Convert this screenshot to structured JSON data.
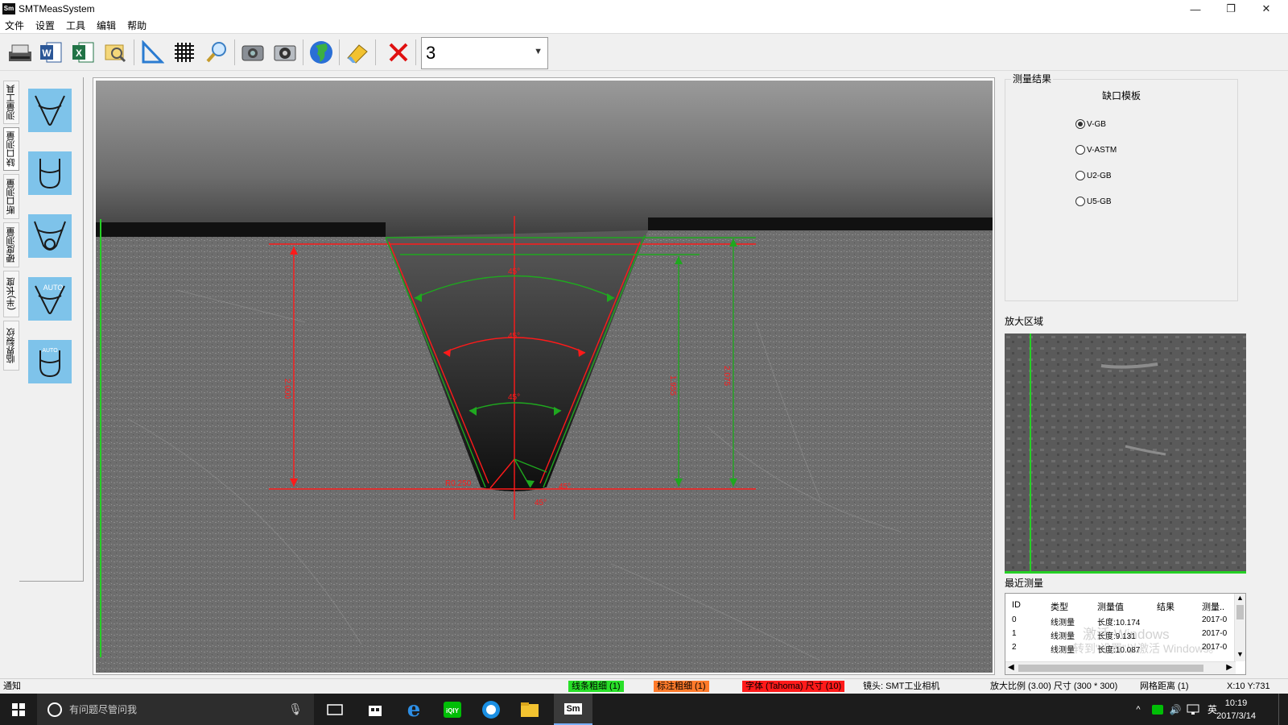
{
  "window": {
    "title": "SMTMeasSystem",
    "logo_text": "Sm",
    "minimize": "—",
    "restore": "❐",
    "close": "✕"
  },
  "menu": [
    "文件",
    "设置",
    "工具",
    "编辑",
    "帮助"
  ],
  "toolbar": {
    "icons": [
      "scanner-icon",
      "word-export-icon",
      "excel-export-icon",
      "image-preview-icon",
      "ruler-angle-icon",
      "grid-icon",
      "magnifier-icon",
      "camera-icon",
      "camera-capture-icon",
      "globe-icon",
      "eraser-icon",
      "delete-icon"
    ],
    "combo_value": "3"
  },
  "side_tabs": [
    "测量工具",
    "缺口测量",
    "断口测量",
    "硬度测量",
    "(半)长度",
    "临界裂纹"
  ],
  "tool_buttons": [
    "v-notch-tool",
    "u-notch-tool",
    "v-notch-wide-tool",
    "auto-v-notch-tool",
    "auto-u-notch-tool"
  ],
  "tool_auto_label": "AUTO",
  "measurement": {
    "angles": [
      "45°",
      "45°",
      "45°",
      "45°",
      "45°"
    ],
    "depth_left": "2.000",
    "depth_mid": "1.955",
    "depth_right": "2.075",
    "radius": "R0.250"
  },
  "results": {
    "group_title": "测量结果",
    "template_title": "缺口模板",
    "options": [
      "V-GB",
      "V-ASTM",
      "U2-GB",
      "U5-GB"
    ],
    "selected": "V-GB"
  },
  "zoom": {
    "title": "放大区域"
  },
  "recent": {
    "title": "最近测量",
    "columns": [
      "ID",
      "类型",
      "测量值",
      "结果",
      "测量.."
    ],
    "rows": [
      {
        "id": "0",
        "type": "线测量",
        "value": "长度:10.174",
        "result": "",
        "time": "2017-0"
      },
      {
        "id": "1",
        "type": "线测量",
        "value": "长度:9.131",
        "result": "",
        "time": "2017-0"
      },
      {
        "id": "2",
        "type": "线测量",
        "value": "长度:10.087",
        "result": "",
        "time": "2017-0"
      }
    ],
    "watermark_1": "激活 Windows",
    "watermark_2": "转到\"设置\"以激活 Windows。"
  },
  "status": {
    "notice": "通知",
    "line_width": "线条粗细 (1)",
    "label_width": "标注粗细 (1)",
    "font": "字体 (Tahoma) 尺寸 (10)",
    "lens": "镜头: SMT工业相机",
    "zoom": "放大比例 (3.00) 尺寸 (300 * 300)",
    "grid": "网格距离 (1)",
    "coords": "X:10 Y:731"
  },
  "colors": {
    "line_width_bg": "#28e028",
    "label_width_bg": "#ff7a2a",
    "font_bg": "#ff1a1a",
    "red": "#ff1a1a",
    "green": "#1fa81f"
  },
  "taskbar": {
    "search_placeholder": "有问题尽管问我",
    "ime": "英",
    "time": "10:19",
    "date": "2017/3/14"
  }
}
